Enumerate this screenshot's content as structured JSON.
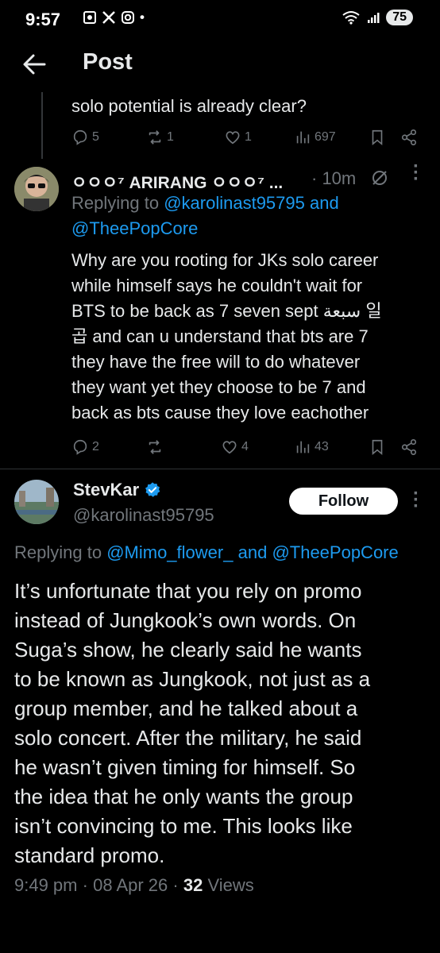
{
  "status_bar": {
    "time": "9:57",
    "battery": "75"
  },
  "header": {
    "title": "Post"
  },
  "prev_reply": {
    "text_tail": "solo potential is already clear?",
    "replies": "5",
    "reposts": "1",
    "likes": "1",
    "views": "697"
  },
  "reply": {
    "author_name": "ㅇㅇㅇ⁷ ARIRANG ㅇㅇㅇ⁷ ...",
    "time": "· 10m",
    "replying_prefix": "Replying to",
    "mention_1": "@karolinast95795",
    "replying_and": "and",
    "mention_2": "@TheePopCore",
    "lines": [
      "Why are you rooting for JKs solo career",
      "while himself says he couldn't wait for",
      "BTS to be back as 7 seven sept سبعة 일",
      "곱 and can u understand that bts are 7",
      "they have the free will to do whatever",
      "they want yet they choose to be 7 and",
      "back as bts cause they love eachother"
    ],
    "replies": "2",
    "reposts": "",
    "likes": "4",
    "views": "43"
  },
  "main_post": {
    "author_name": "StevKar",
    "handle": "@karolinast95795",
    "follow_label": "Follow",
    "replying_prefix": "Replying to",
    "mention_1": "@Mimo_flower_",
    "replying_and": "and",
    "mention_2": "@TheePopCore",
    "lines": [
      "It’s unfortunate that you rely on promo",
      "instead of Jungkook’s own words. On",
      "Suga’s show, he clearly said he wants",
      "to be known as Jungkook, not just as a",
      "group member, and he talked about a",
      "solo concert. After the military, he said",
      "he wasn’t given timing for himself. So",
      "the idea that he only wants the group",
      "isn’t convincing to me. This looks like",
      "standard promo."
    ],
    "time": "9:49 pm",
    "date": "08 Apr 26",
    "views_count": "32",
    "views_label": "Views"
  },
  "colors": {
    "accent": "#1d9bf0",
    "muted": "#71767b",
    "verified": "#1d9bf0"
  }
}
